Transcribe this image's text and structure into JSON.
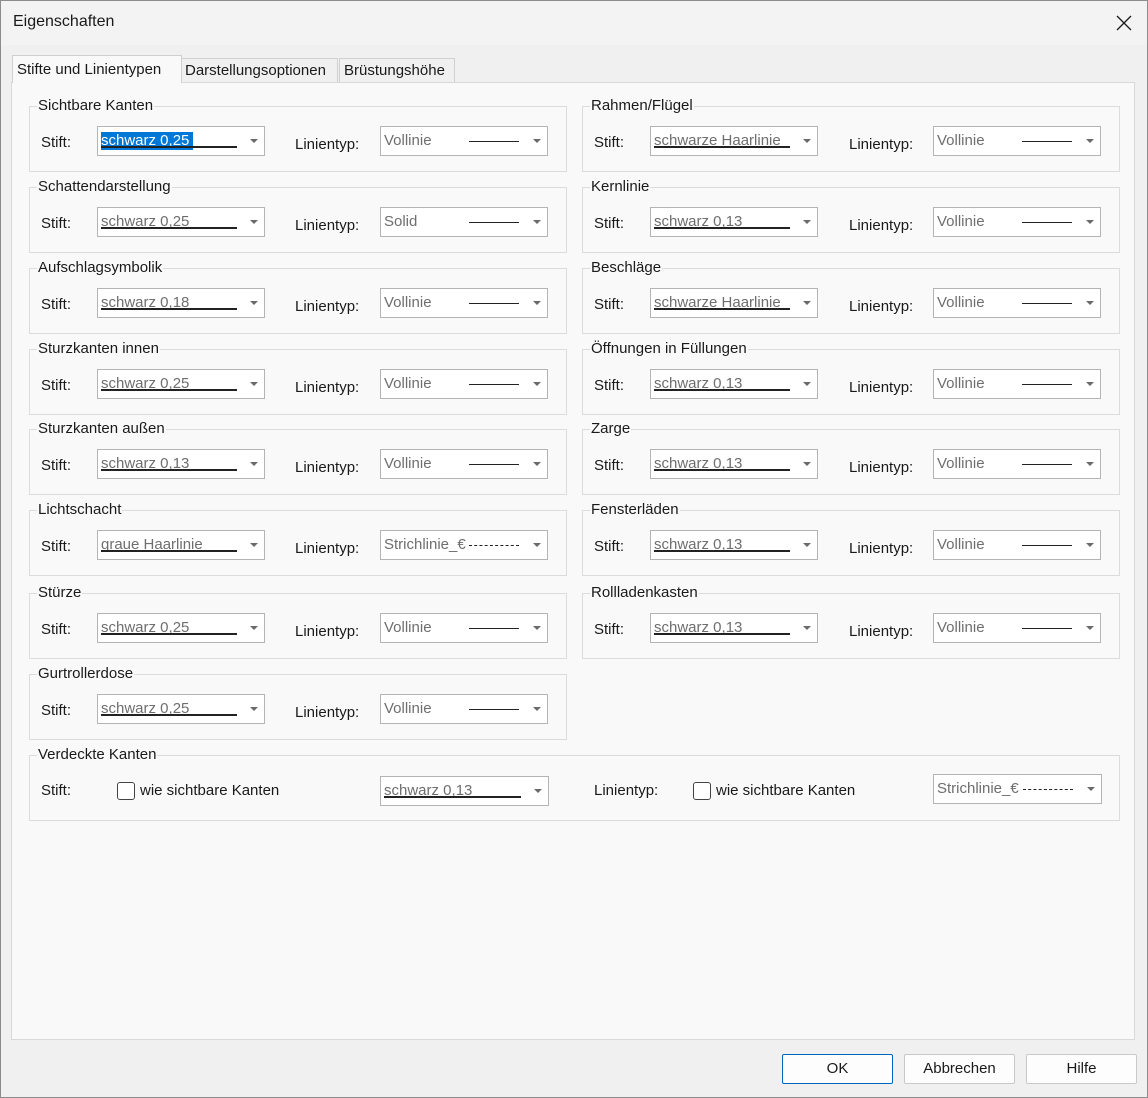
{
  "window": {
    "title": "Eigenschaften"
  },
  "tabs": [
    {
      "label": "Stifte und Linientypen",
      "active": true
    },
    {
      "label": "Darstellungsoptionen",
      "active": false
    },
    {
      "label": "Brüstungshöhe",
      "active": false
    }
  ],
  "common": {
    "pen_label": "Stift:",
    "linetype_label": "Linientyp:"
  },
  "groups": [
    {
      "title": "Sichtbare Kanten",
      "pen": "schwarz 0,25",
      "linetype": "Vollinie",
      "selected": true
    },
    {
      "title": "Rahmen/Flügel",
      "pen": "schwarze Haarlinie",
      "linetype": "Vollinie"
    },
    {
      "title": "Schattendarstellung",
      "pen": "schwarz 0,25",
      "linetype": "Solid"
    },
    {
      "title": "Kernlinie",
      "pen": "schwarz 0,13",
      "linetype": "Vollinie"
    },
    {
      "title": "Aufschlagsymbolik",
      "pen": "schwarz 0,18",
      "linetype": "Vollinie"
    },
    {
      "title": "Beschläge",
      "pen": "schwarze Haarlinie",
      "linetype": "Vollinie"
    },
    {
      "title": "Sturzkanten innen",
      "pen": "schwarz 0,25",
      "linetype": "Vollinie"
    },
    {
      "title": "Öffnungen in Füllungen",
      "pen": "schwarz 0,13",
      "linetype": "Vollinie"
    },
    {
      "title": "Sturzkanten außen",
      "pen": "schwarz 0,13",
      "linetype": "Vollinie"
    },
    {
      "title": "Zarge",
      "pen": "schwarz 0,13",
      "linetype": "Vollinie"
    },
    {
      "title": "Lichtschacht",
      "pen": "graue Haarlinie",
      "linetype": "Strichlinie_€",
      "dashed": true
    },
    {
      "title": "Fensterläden",
      "pen": "schwarz 0,13",
      "linetype": "Vollinie"
    },
    {
      "title": "Stürze",
      "pen": "schwarz 0,25",
      "linetype": "Vollinie"
    },
    {
      "title": "Rollladenkasten",
      "pen": "schwarz 0,13",
      "linetype": "Vollinie"
    },
    {
      "title": "Gurtrollerdose",
      "pen": "schwarz 0,25",
      "linetype": "Vollinie"
    }
  ],
  "hidden_edges": {
    "title": "Verdeckte Kanten",
    "pen_checkbox_label": "wie sichtbare Kanten",
    "pen": "schwarz 0,13",
    "linetype_checkbox_label": "wie sichtbare Kanten",
    "linetype": "Strichlinie_€",
    "dashed": true
  },
  "buttons": {
    "ok": "OK",
    "cancel": "Abbrechen",
    "help": "Hilfe"
  },
  "colors": {
    "selection": "#0078d7",
    "primary_border": "#0067c0"
  }
}
